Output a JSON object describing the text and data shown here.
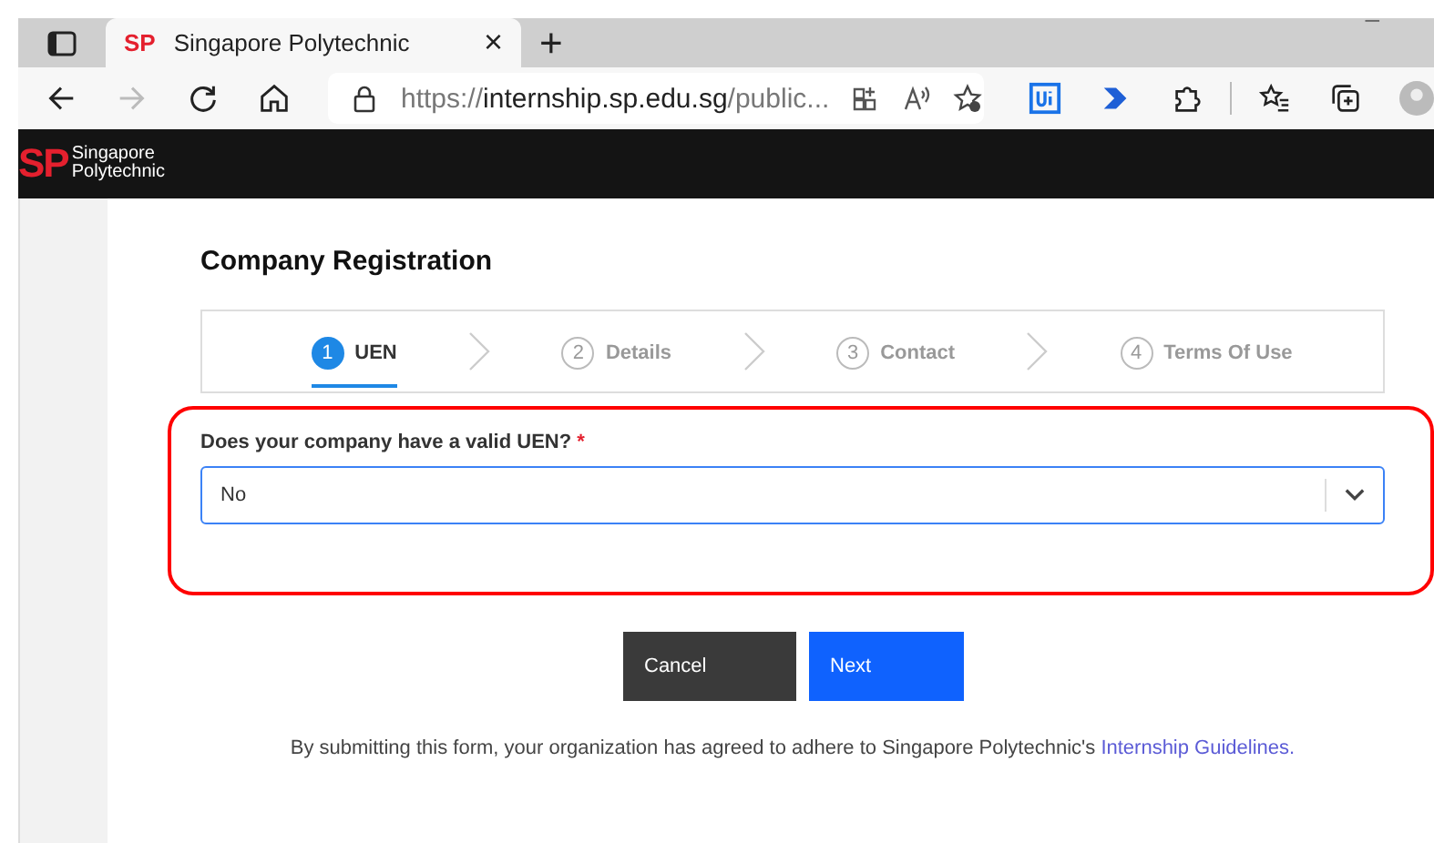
{
  "browser": {
    "tab": {
      "favicon": "SP",
      "title": "Singapore Polytechnic",
      "close": "×"
    },
    "new_tab": "+",
    "minimize": "–",
    "url": {
      "scheme": "https://",
      "domain": "internship.sp.edu.sg",
      "path": "/public..."
    }
  },
  "site_header": {
    "logo": "SP",
    "logo_text": [
      "Singapore",
      "Polytechnic"
    ]
  },
  "title": "Company Registration",
  "steps": [
    {
      "number": "1",
      "label": "UEN",
      "selected": true
    },
    {
      "number": "2",
      "label": "Details",
      "selected": false
    },
    {
      "number": "3",
      "label": "Contact",
      "selected": false
    },
    {
      "number": "4",
      "label": "Terms Of Use",
      "selected": false
    }
  ],
  "question": {
    "label": "Does your company have a valid UEN?",
    "required": "*",
    "value": "No"
  },
  "buttons": [
    {
      "kind": "secondary",
      "label": "Cancel"
    },
    {
      "kind": "primary",
      "label": "Next"
    }
  ],
  "footer": {
    "text": "By submitting this form, your organization has agreed to adhere to Singapore Polytechnic's",
    "link": "Internship Guidelines."
  }
}
